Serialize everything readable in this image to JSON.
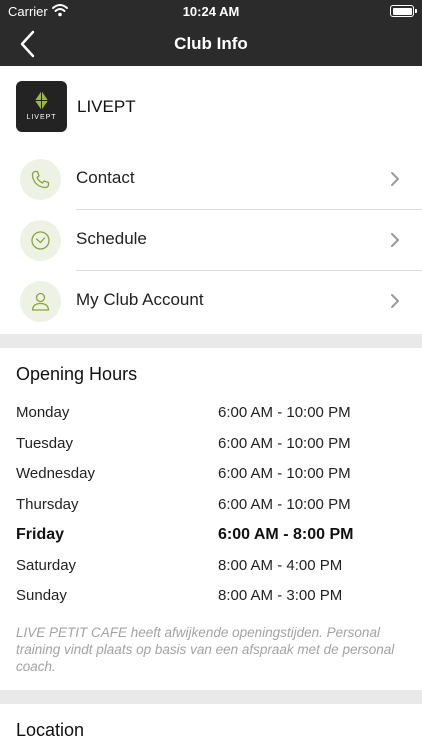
{
  "status": {
    "carrier": "Carrier",
    "time": "10:24 AM"
  },
  "nav": {
    "title": "Club Info"
  },
  "club": {
    "name": "LIVEPT",
    "logo_text": "LIVEPT"
  },
  "menu": [
    {
      "label": "Contact",
      "icon": "phone-icon"
    },
    {
      "label": "Schedule",
      "icon": "clock-icon"
    },
    {
      "label": "My Club Account",
      "icon": "user-icon"
    }
  ],
  "hours": {
    "title": "Opening Hours",
    "rows": [
      {
        "day": "Monday",
        "hours": "6:00 AM - 10:00 PM"
      },
      {
        "day": "Tuesday",
        "hours": "6:00 AM - 10:00 PM"
      },
      {
        "day": "Wednesday",
        "hours": "6:00 AM - 10:00 PM"
      },
      {
        "day": "Thursday",
        "hours": "6:00 AM - 10:00 PM"
      },
      {
        "day": "Friday",
        "hours": "6:00 AM - 8:00 PM",
        "today": true
      },
      {
        "day": "Saturday",
        "hours": "8:00 AM - 4:00 PM"
      },
      {
        "day": "Sunday",
        "hours": "8:00 AM - 3:00 PM"
      }
    ],
    "note": "LIVE PETIT CAFE heeft afwijkende openingstijden. Personal training vindt plaats op basis van een afspraak met de personal coach."
  },
  "location": {
    "title": "Location"
  },
  "colors": {
    "navbar": "#2b2b2b",
    "accent": "#9bb83a",
    "icon_bg": "#eef2e4"
  }
}
